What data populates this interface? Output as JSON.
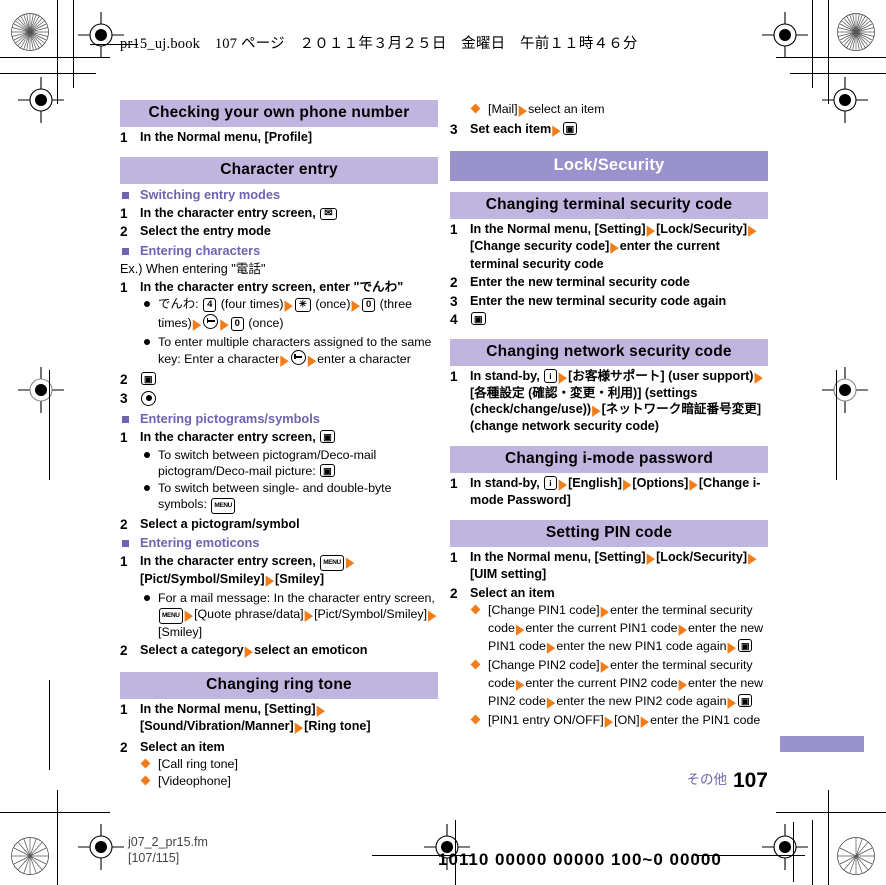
{
  "page_header": "pr15_uj.book　107 ページ　２０１１年３月２５日　金曜日　午前１１時４６分",
  "left_column": [
    {
      "kind": "banner-sec",
      "text": "Checking your own phone number"
    },
    {
      "kind": "step",
      "num": "1",
      "parts": [
        {
          "t": "text",
          "v": "In the Normal menu, [Profile]"
        }
      ]
    },
    {
      "kind": "banner-sec",
      "text": "Character entry"
    },
    {
      "kind": "subhead",
      "text": "Switching entry modes"
    },
    {
      "kind": "step",
      "num": "1",
      "parts": [
        {
          "t": "text",
          "v": "In the character entry screen, "
        },
        {
          "t": "key",
          "style": "mail",
          "v": "✉"
        }
      ]
    },
    {
      "kind": "step",
      "num": "2",
      "parts": [
        {
          "t": "text",
          "v": "Select the entry mode"
        }
      ]
    },
    {
      "kind": "subhead",
      "text": "Entering characters"
    },
    {
      "kind": "plain",
      "parts": [
        {
          "t": "text",
          "v": "Ex.) When entering \"電話\""
        }
      ]
    },
    {
      "kind": "step",
      "num": "1",
      "parts": [
        {
          "t": "text",
          "v": "In the character entry screen, enter \"でんわ\""
        }
      ]
    },
    {
      "kind": "bullet",
      "parts": [
        {
          "t": "text",
          "v": "でんわ: "
        },
        {
          "t": "key",
          "v": "4"
        },
        {
          "t": "text",
          "v": " (four times)"
        },
        {
          "t": "arrow"
        },
        {
          "t": "key",
          "v": "✳"
        },
        {
          "t": "text",
          "v": " (once)"
        },
        {
          "t": "arrow"
        },
        {
          "t": "key",
          "v": "0"
        },
        {
          "t": "text",
          "v": " (three times)"
        },
        {
          "t": "arrow"
        },
        {
          "t": "keyc",
          "style": "back"
        },
        {
          "t": "arrow"
        },
        {
          "t": "key",
          "v": "0"
        },
        {
          "t": "text",
          "v": " (once)"
        }
      ]
    },
    {
      "kind": "bullet",
      "parts": [
        {
          "t": "text",
          "v": "To enter multiple characters assigned to the same key: Enter a character"
        },
        {
          "t": "arrow"
        },
        {
          "t": "keyc",
          "style": "back"
        },
        {
          "t": "arrow"
        },
        {
          "t": "text",
          "v": "enter a character"
        }
      ]
    },
    {
      "kind": "step",
      "num": "2",
      "parts": [
        {
          "t": "key",
          "style": "cam",
          "v": "▣"
        }
      ]
    },
    {
      "kind": "step",
      "num": "3",
      "parts": [
        {
          "t": "keyc",
          "style": "sel"
        }
      ]
    },
    {
      "kind": "subhead",
      "text": "Entering pictograms/symbols"
    },
    {
      "kind": "step",
      "num": "1",
      "parts": [
        {
          "t": "text",
          "v": "In the character entry screen, "
        },
        {
          "t": "key",
          "style": "cam",
          "v": "▣"
        }
      ]
    },
    {
      "kind": "bullet",
      "parts": [
        {
          "t": "text",
          "v": "To switch between pictogram/Deco-mail pictogram/Deco-mail picture: "
        },
        {
          "t": "key",
          "style": "cam",
          "v": "▣"
        }
      ]
    },
    {
      "kind": "bullet",
      "parts": [
        {
          "t": "text",
          "v": "To switch between single- and double-byte symbols: "
        },
        {
          "t": "key",
          "style": "menu",
          "v": "MENU"
        }
      ]
    },
    {
      "kind": "step",
      "num": "2",
      "parts": [
        {
          "t": "text",
          "v": "Select a pictogram/symbol"
        }
      ]
    },
    {
      "kind": "subhead",
      "text": "Entering emoticons"
    },
    {
      "kind": "step",
      "num": "1",
      "parts": [
        {
          "t": "text",
          "v": "In the character entry screen, "
        },
        {
          "t": "key",
          "style": "menu",
          "v": "MENU"
        },
        {
          "t": "arrow"
        },
        {
          "t": "text",
          "v": "[Pict/Symbol/Smiley]"
        },
        {
          "t": "arrow"
        },
        {
          "t": "text",
          "v": "[Smiley]"
        }
      ]
    },
    {
      "kind": "bullet",
      "parts": [
        {
          "t": "text",
          "v": "For a mail message: In the character entry screen, "
        },
        {
          "t": "key",
          "style": "menu",
          "v": "MENU"
        },
        {
          "t": "arrow"
        },
        {
          "t": "text",
          "v": "[Quote phrase/data]"
        },
        {
          "t": "arrow"
        },
        {
          "t": "text",
          "v": "[Pict/Symbol/Smiley]"
        },
        {
          "t": "arrow"
        },
        {
          "t": "text",
          "v": "[Smiley]"
        }
      ]
    },
    {
      "kind": "step",
      "num": "2",
      "parts": [
        {
          "t": "text",
          "v": "Select a category"
        },
        {
          "t": "arrow"
        },
        {
          "t": "text",
          "v": "select an emoticon"
        }
      ]
    },
    {
      "kind": "banner-sec",
      "text": "Changing ring tone"
    },
    {
      "kind": "step",
      "num": "1",
      "parts": [
        {
          "t": "text",
          "v": "In the Normal menu, [Setting]"
        },
        {
          "t": "arrow"
        },
        {
          "t": "text",
          "v": "[Sound/Vibration/Manner]"
        },
        {
          "t": "arrow"
        },
        {
          "t": "text",
          "v": "[Ring tone]"
        }
      ]
    },
    {
      "kind": "step",
      "num": "2",
      "parts": [
        {
          "t": "text",
          "v": "Select an item"
        }
      ]
    },
    {
      "kind": "diamond",
      "parts": [
        {
          "t": "text",
          "v": "[Call ring tone]"
        }
      ]
    },
    {
      "kind": "diamond",
      "parts": [
        {
          "t": "text",
          "v": "[Videophone]"
        }
      ]
    }
  ],
  "right_column": [
    {
      "kind": "diamond",
      "parts": [
        {
          "t": "text",
          "v": "[Mail]"
        },
        {
          "t": "arrow"
        },
        {
          "t": "text",
          "v": "select an item"
        }
      ]
    },
    {
      "kind": "step",
      "num": "3",
      "parts": [
        {
          "t": "text",
          "v": "Set each item"
        },
        {
          "t": "arrow"
        },
        {
          "t": "key",
          "style": "cam",
          "v": "▣"
        }
      ]
    },
    {
      "kind": "banner-main",
      "text": "Lock/Security"
    },
    {
      "kind": "banner-sec",
      "text": "Changing terminal security code"
    },
    {
      "kind": "step",
      "num": "1",
      "parts": [
        {
          "t": "text",
          "v": "In the Normal menu, [Setting]"
        },
        {
          "t": "arrow"
        },
        {
          "t": "text",
          "v": "[Lock/Security]"
        },
        {
          "t": "arrow"
        },
        {
          "t": "text",
          "v": "[Change security code]"
        },
        {
          "t": "arrow"
        },
        {
          "t": "text",
          "v": "enter the current terminal security code"
        }
      ]
    },
    {
      "kind": "step",
      "num": "2",
      "parts": [
        {
          "t": "text",
          "v": "Enter the new terminal security code"
        }
      ]
    },
    {
      "kind": "step",
      "num": "3",
      "parts": [
        {
          "t": "text",
          "v": "Enter the new terminal security code again"
        }
      ]
    },
    {
      "kind": "step",
      "num": "4",
      "parts": [
        {
          "t": "key",
          "style": "cam",
          "v": "▣"
        }
      ]
    },
    {
      "kind": "banner-sec",
      "text": "Changing network security code"
    },
    {
      "kind": "step",
      "num": "1",
      "parts": [
        {
          "t": "text",
          "v": "In stand-by, "
        },
        {
          "t": "key",
          "style": "imode",
          "v": "i"
        },
        {
          "t": "arrow"
        },
        {
          "t": "text",
          "v": "[お客様サポート] (user support)"
        },
        {
          "t": "arrow"
        },
        {
          "t": "text",
          "v": "[各種設定 (確認・変更・利用)] (settings (check/change/use))"
        },
        {
          "t": "arrow"
        },
        {
          "t": "text",
          "v": "[ネットワーク暗証番号変更] (change network security code)"
        }
      ]
    },
    {
      "kind": "banner-sec",
      "text": "Changing i-mode password"
    },
    {
      "kind": "step",
      "num": "1",
      "parts": [
        {
          "t": "text",
          "v": "In stand-by, "
        },
        {
          "t": "key",
          "style": "imode",
          "v": "i"
        },
        {
          "t": "arrow"
        },
        {
          "t": "text",
          "v": "[English]"
        },
        {
          "t": "arrow"
        },
        {
          "t": "text",
          "v": "[Options]"
        },
        {
          "t": "arrow"
        },
        {
          "t": "text",
          "v": "[Change i-mode Password]"
        }
      ]
    },
    {
      "kind": "banner-sec",
      "text": "Setting PIN code"
    },
    {
      "kind": "step",
      "num": "1",
      "parts": [
        {
          "t": "text",
          "v": "In the Normal menu, [Setting]"
        },
        {
          "t": "arrow"
        },
        {
          "t": "text",
          "v": "[Lock/Security]"
        },
        {
          "t": "arrow"
        },
        {
          "t": "text",
          "v": "[UIM setting]"
        }
      ]
    },
    {
      "kind": "step",
      "num": "2",
      "parts": [
        {
          "t": "text",
          "v": "Select an item"
        }
      ]
    },
    {
      "kind": "diamond",
      "parts": [
        {
          "t": "text",
          "v": "[Change PIN1 code]"
        },
        {
          "t": "arrow"
        },
        {
          "t": "text",
          "v": "enter the terminal security code"
        },
        {
          "t": "arrow"
        },
        {
          "t": "text",
          "v": "enter the current PIN1 code"
        },
        {
          "t": "arrow"
        },
        {
          "t": "text",
          "v": "enter the new PIN1 code"
        },
        {
          "t": "arrow"
        },
        {
          "t": "text",
          "v": "enter the new PIN1 code again"
        },
        {
          "t": "arrow"
        },
        {
          "t": "key",
          "style": "cam",
          "v": "▣"
        }
      ]
    },
    {
      "kind": "diamond",
      "parts": [
        {
          "t": "text",
          "v": "[Change PIN2 code]"
        },
        {
          "t": "arrow"
        },
        {
          "t": "text",
          "v": "enter the terminal security code"
        },
        {
          "t": "arrow"
        },
        {
          "t": "text",
          "v": "enter the current PIN2 code"
        },
        {
          "t": "arrow"
        },
        {
          "t": "text",
          "v": "enter the new PIN2 code"
        },
        {
          "t": "arrow"
        },
        {
          "t": "text",
          "v": "enter the new PIN2 code again"
        },
        {
          "t": "arrow"
        },
        {
          "t": "key",
          "style": "cam",
          "v": "▣"
        }
      ]
    },
    {
      "kind": "diamond",
      "parts": [
        {
          "t": "text",
          "v": "[PIN1 entry ON/OFF]"
        },
        {
          "t": "arrow"
        },
        {
          "t": "text",
          "v": "[ON]"
        },
        {
          "t": "arrow"
        },
        {
          "t": "text",
          "v": "enter the PIN1 code"
        }
      ]
    }
  ],
  "footer": {
    "section_label_jp": "その他",
    "page_number": "107",
    "file_name": "j07_2_pr15.fm",
    "file_range": "[107/115]",
    "barcode_text": "10110  00000  00000  100~0  00000"
  },
  "colors": {
    "banner_main_bg": "#9a92cd",
    "banner_sec_bg": "#bfb5de",
    "subhead_text": "#6f62b0",
    "arrow": "#f07d1a",
    "diamond": "#f07d1a"
  }
}
